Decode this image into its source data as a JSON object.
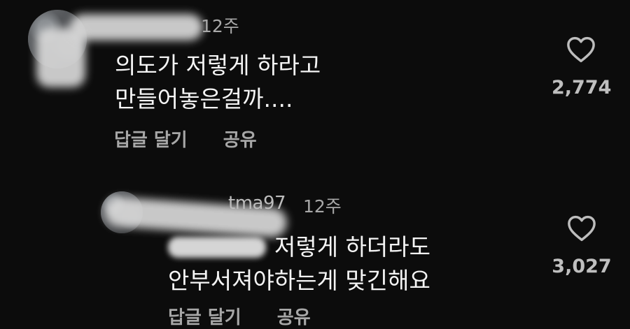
{
  "comments": [
    {
      "username": "",
      "time": "12주",
      "text_line1": "의도가 저렇게 하라고",
      "text_line2": "만들어놓은걸까....",
      "reply_label": "답글 달기",
      "share_label": "공유",
      "likes": "2,774"
    },
    {
      "username": "tma97",
      "time": "12주",
      "text_line1": "저렇게 하더라도",
      "text_line2": "안부서져야하는게 맞긴해요",
      "reply_label": "답글 달기",
      "share_label": "공유",
      "likes": "3,027"
    }
  ],
  "icons": {
    "like": "heart-outline-icon"
  }
}
